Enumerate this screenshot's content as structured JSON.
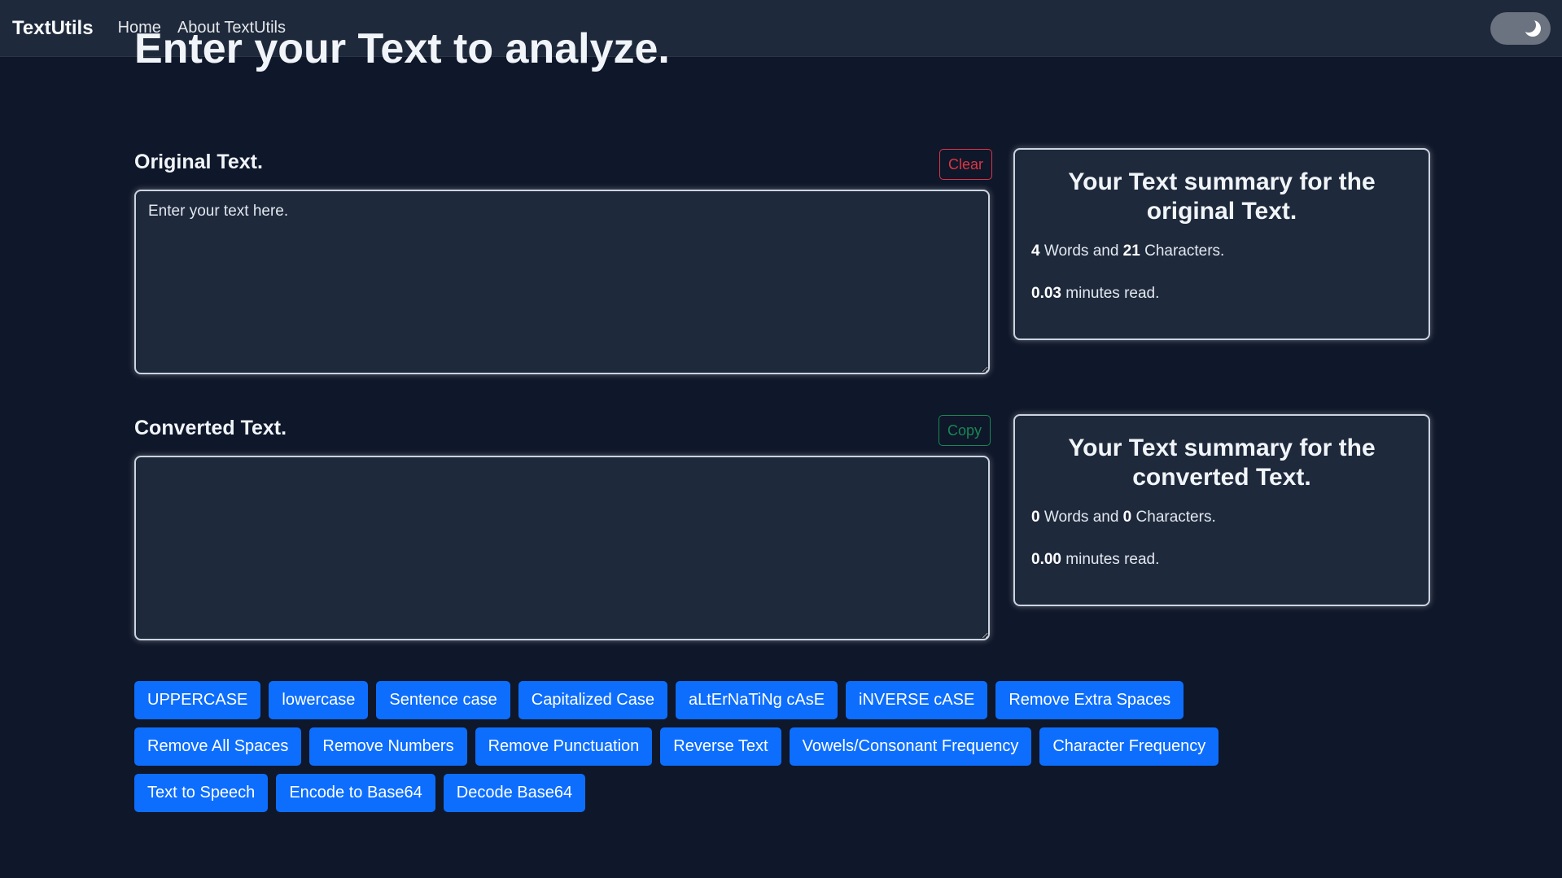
{
  "navbar": {
    "brand": "TextUtils",
    "links": [
      "Home",
      "About TextUtils"
    ]
  },
  "page": {
    "heading": "Enter your Text to analyze."
  },
  "original": {
    "label": "Original Text.",
    "clear_label": "Clear",
    "placeholder": "Enter your text here.",
    "value": ""
  },
  "converted": {
    "label": "Converted Text.",
    "copy_label": "Copy",
    "value": ""
  },
  "summary_original": {
    "title": "Your Text summary for the original Text.",
    "words": "4",
    "words_label": "Words and",
    "chars": "21",
    "chars_label": "Characters.",
    "minutes": "0.03",
    "minutes_label": "minutes read."
  },
  "summary_converted": {
    "title": "Your Text summary for the converted Text.",
    "words": "0",
    "words_label": "Words and",
    "chars": "0",
    "chars_label": "Characters.",
    "minutes": "0.00",
    "minutes_label": "minutes read."
  },
  "actions": [
    "UPPERCASE",
    "lowercase",
    "Sentence case",
    "Capitalized Case",
    "aLtErNaTiNg cAsE",
    "iNVERSE cASE",
    "Remove Extra Spaces",
    "Remove All Spaces",
    "Remove Numbers",
    "Remove Punctuation",
    "Reverse Text",
    "Vowels/Consonant Frequency",
    "Character Frequency",
    "Text to Speech",
    "Encode to Base64",
    "Decode Base64"
  ],
  "colors": {
    "background": "#0f172a",
    "panel": "#1e293b",
    "primary": "#0d6efd",
    "danger": "#dc3545",
    "success": "#198754"
  },
  "icons": {
    "theme_toggle": "moon-icon"
  }
}
